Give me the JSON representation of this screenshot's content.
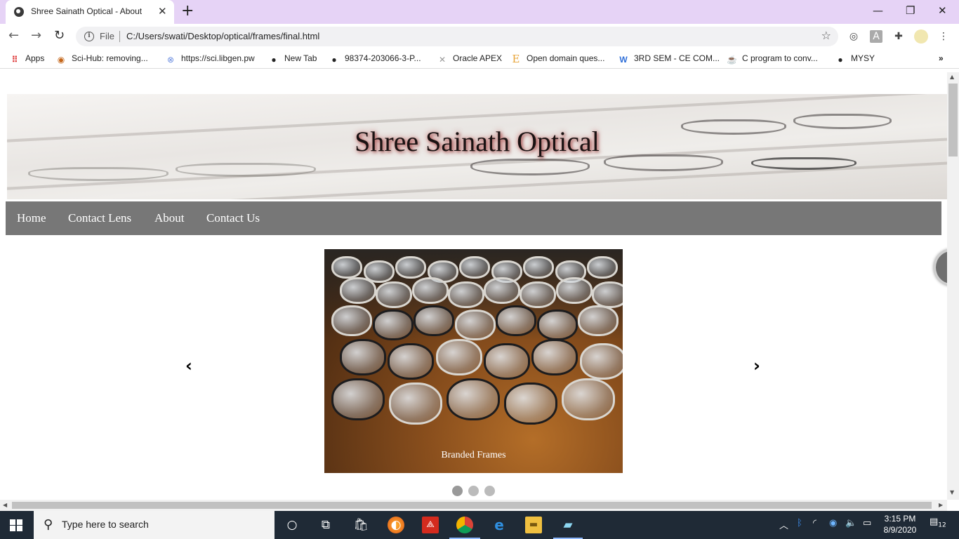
{
  "browser": {
    "tab_title": "Shree Sainath Optical - About",
    "omnibox_label": "File",
    "url": "C:/Users/swati/Desktop/optical/frames/final.html",
    "bookmarks": [
      {
        "label": "Apps",
        "icon": "apps-grid-icon"
      },
      {
        "label": "Sci-Hub: removing...",
        "icon": "sci-hub-icon"
      },
      {
        "label": "https://sci.libgen.pw",
        "icon": "libgen-icon"
      },
      {
        "label": "New Tab",
        "icon": "globe-icon"
      },
      {
        "label": "98374-203066-3-P...",
        "icon": "globe-icon"
      },
      {
        "label": "Oracle APEX",
        "icon": "oracle-apex-icon"
      },
      {
        "label": "Open domain ques...",
        "icon": "letter-e-icon"
      },
      {
        "label": "3RD SEM - CE COM...",
        "icon": "letter-w-icon"
      },
      {
        "label": "C program to conv...",
        "icon": "coffee-cup-icon"
      },
      {
        "label": "MYSY",
        "icon": "globe-icon"
      }
    ]
  },
  "site": {
    "title": "Shree Sainath Optical",
    "nav": [
      "Home",
      "Contact Lens",
      "About",
      "Contact Us"
    ],
    "carousel": {
      "caption": "Branded Frames",
      "prev": "‹",
      "next": "›",
      "slide_count": 3,
      "active_slide": 1
    }
  },
  "taskbar": {
    "search_placeholder": "Type here to search",
    "time": "3:15 PM",
    "date": "8/9/2020",
    "notification_count": "12"
  }
}
